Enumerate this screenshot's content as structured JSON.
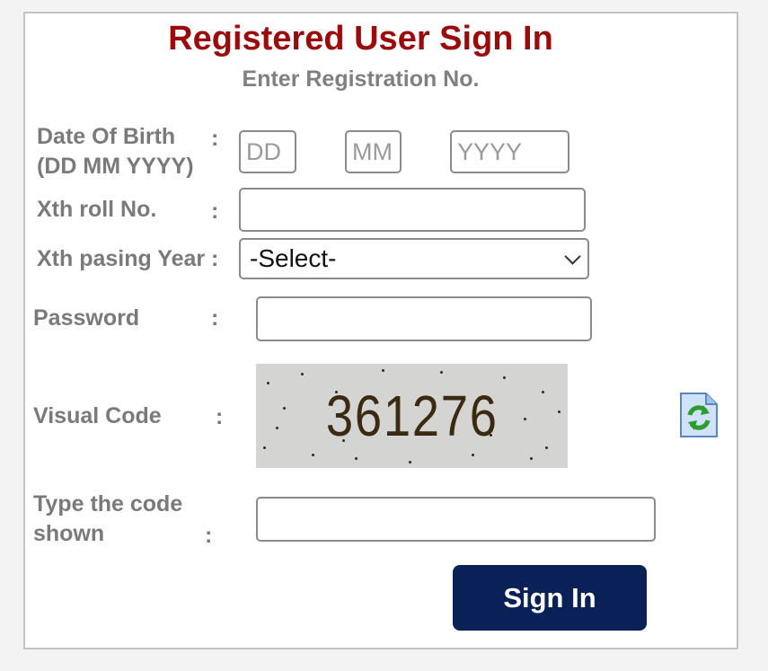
{
  "title": "Registered User Sign In",
  "subtitle": "Enter Registration No.",
  "dob": {
    "label_line1": "Date Of Birth",
    "label_line2": "(DD MM YYYY)",
    "colon": ":",
    "day_placeholder": "DD",
    "month_placeholder": "MM",
    "year_placeholder": "YYYY"
  },
  "roll": {
    "label": "Xth roll No.",
    "colon": ":",
    "value": ""
  },
  "passing_year": {
    "label": "Xth pasing Year :",
    "selected": "-Select-"
  },
  "password": {
    "label": "Password",
    "colon": ":",
    "value": ""
  },
  "visual_code": {
    "label": "Visual Code",
    "colon": ":",
    "code": "361276",
    "refresh_icon": "refresh-icon"
  },
  "type_code": {
    "label_line1": "Type the code",
    "label_line2": "shown",
    "colon": ":",
    "value": ""
  },
  "sign_in_button": "Sign In",
  "colors": {
    "title": "#9b0b0b",
    "label": "#7a7a7a",
    "button_bg": "#0a2158",
    "button_text": "#ffffff",
    "refresh_green": "#2e9b2e",
    "refresh_bg": "#9cc3ee"
  }
}
